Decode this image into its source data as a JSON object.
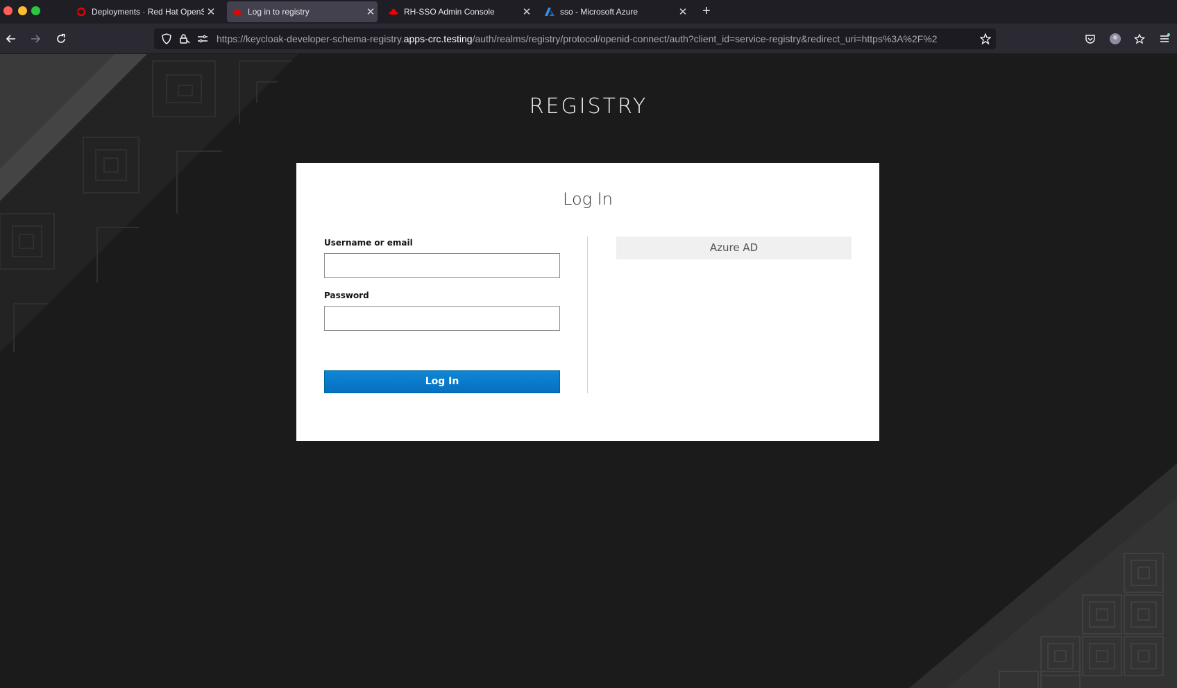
{
  "browser": {
    "tabs": [
      {
        "title": "Deployments · Red Hat OpenShift",
        "icon": "openshift-icon",
        "active": false
      },
      {
        "title": "Log in to registry",
        "icon": "redhat-icon",
        "active": true
      },
      {
        "title": "RH-SSO Admin Console",
        "icon": "redhat-icon",
        "active": false
      },
      {
        "title": "sso - Microsoft Azure",
        "icon": "azure-icon",
        "active": false
      }
    ],
    "url_prefix": "https://keycloak-developer-schema-registry.",
    "url_host": "apps-crc.testing",
    "url_path": "/auth/realms/registry/protocol/openid-connect/auth?client_id=service-registry&redirect_uri=https%3A%2F%2"
  },
  "page": {
    "brand": "REGISTRY",
    "login_title": "Log In",
    "username_label": "Username or email",
    "username_value": "",
    "password_label": "Password",
    "password_value": "",
    "login_button": "Log In",
    "idp_button": "Azure AD"
  },
  "colors": {
    "accent": "#0670bf",
    "background": "#1b1b1b",
    "redhat": "#ee0000"
  }
}
